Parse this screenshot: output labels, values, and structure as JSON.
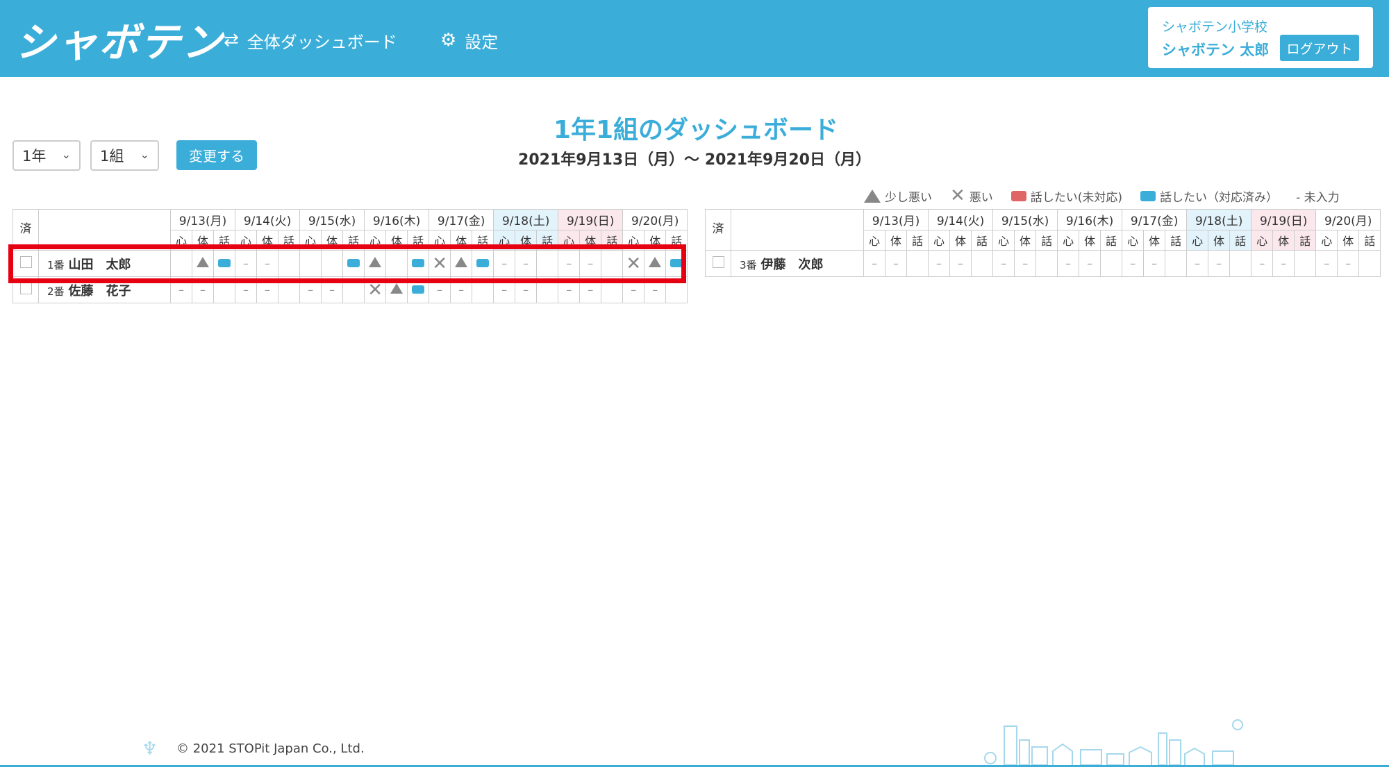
{
  "header": {
    "logo": "シャボテン",
    "nav": {
      "dashboard": "全体ダッシュボード",
      "settings": "設定"
    },
    "school": "シャボテン小学校",
    "user": "シャボテン 太郎",
    "logout": "ログアウト"
  },
  "page": {
    "title": "1年1組のダッシュボード",
    "date_range": "2021年9月13日（月）～ 2021年9月20日（月）"
  },
  "filters": {
    "grade": "1年",
    "class": "1組",
    "change_button": "変更する"
  },
  "legend": {
    "slightly_bad": "少し悪い",
    "bad": "悪い",
    "want_talk_unhandled": "話したい(未対応)",
    "want_talk_handled": "話したい（対応済み）",
    "not_entered": "- 未入力"
  },
  "table": {
    "header_vertical": "済",
    "dates": [
      "9/13(月)",
      "9/14(火)",
      "9/15(水)",
      "9/16(木)",
      "9/17(金)",
      "9/18(土)",
      "9/19(日)",
      "9/20(月)"
    ],
    "sub": [
      "心",
      "体",
      "話"
    ],
    "dash": "–"
  },
  "students": [
    {
      "num": "1番",
      "name": "山田　太郎"
    },
    {
      "num": "2番",
      "name": "佐藤　花子"
    },
    {
      "num": "3番",
      "name": "伊藤　次郎"
    }
  ],
  "colors": {
    "accent": "#3badd9",
    "highlight": "#e60012",
    "red_bubble": "#e06666",
    "symbol_gray": "#888888"
  },
  "footer": {
    "copyright": "© 2021 STOPit Japan Co., Ltd."
  }
}
